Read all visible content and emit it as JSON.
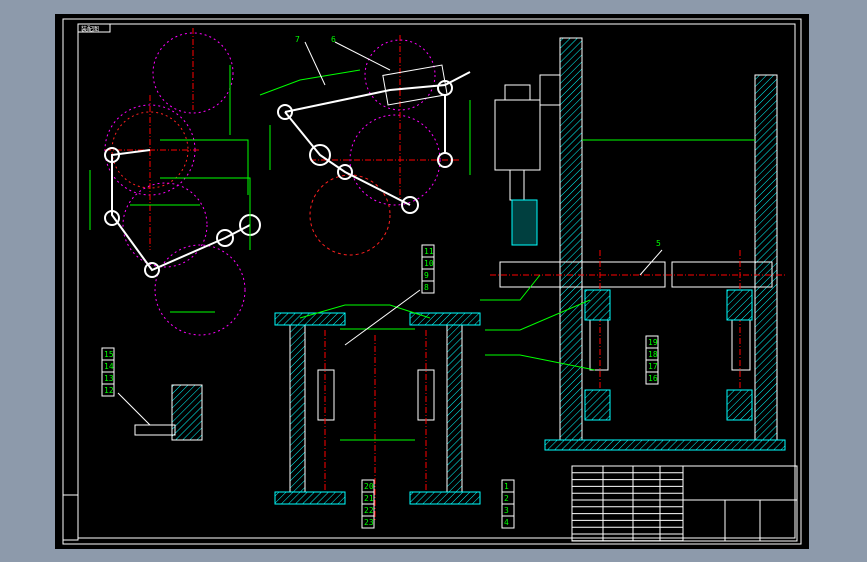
{
  "drawing": {
    "title_tag": "装配图",
    "colors": {
      "background": "#000000",
      "frame": "#ffffff",
      "dimension": "#00ff00",
      "centerline": "#ff0000",
      "hatch": "#00ffff",
      "construction": "#ff00ff",
      "viewport_bg": "#8d9aab"
    },
    "top_callouts": [
      "7",
      "6"
    ],
    "section_callout": "5",
    "balloons_top_middle": [
      "11",
      "10",
      "9",
      "8"
    ],
    "balloons_bottom_left": [
      "20",
      "21",
      "22",
      "23"
    ],
    "balloons_bottom_right": [
      "1",
      "2",
      "3",
      "4"
    ],
    "balloons_right": [
      "19",
      "18",
      "17",
      "16"
    ],
    "balloons_detail": [
      "15",
      "14",
      "13",
      "12"
    ]
  }
}
